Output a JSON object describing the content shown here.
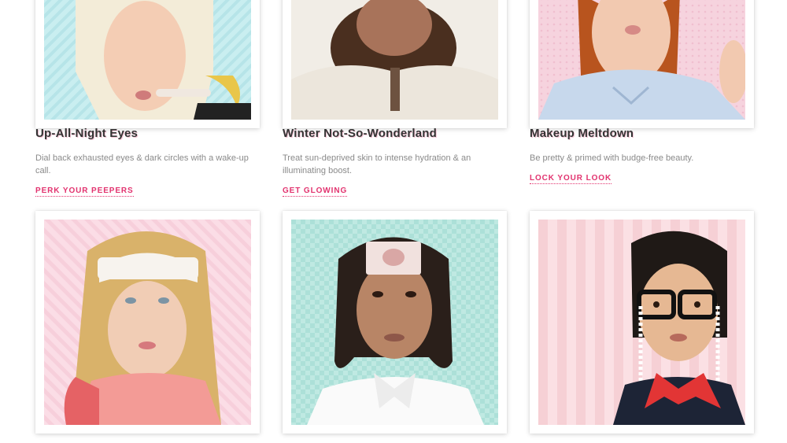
{
  "products": [
    {
      "title": "Up-All-Night Eyes",
      "description": "Dial back exhausted eyes & dark circles with a wake-up call.",
      "cta": "PERK YOUR PEEPERS",
      "bg_color": "#c9eef0"
    },
    {
      "title": "Winter Not-So-Wonderland",
      "description": "Treat sun-deprived skin to intense hydration & an illuminating boost.",
      "cta": "GET GLOWING",
      "bg_color": "#f1ede6"
    },
    {
      "title": "Makeup Meltdown",
      "description": "Be pretty & primed with budge-free beauty.",
      "cta": "LOCK YOUR LOOK",
      "bg_color": "#f6d3de"
    },
    {
      "bg_color": "#fbdde6"
    },
    {
      "bg_color": "#bfe9e2"
    },
    {
      "bg_color": "#fbe0e4"
    }
  ],
  "colors": {
    "accent": "#e2336f",
    "title": "#333333",
    "title_shadow": "#f6c6d6",
    "description": "#8a8a8a"
  }
}
